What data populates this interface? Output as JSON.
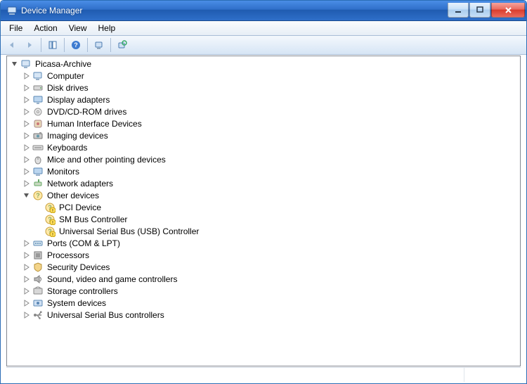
{
  "window_title": "Device Manager",
  "menu": {
    "file": "File",
    "action": "Action",
    "view": "View",
    "help": "Help"
  },
  "root": {
    "label": "Picasa-Archive"
  },
  "categories": [
    {
      "label": "Computer",
      "icon": "computer"
    },
    {
      "label": "Disk drives",
      "icon": "disk"
    },
    {
      "label": "Display adapters",
      "icon": "display"
    },
    {
      "label": "DVD/CD-ROM drives",
      "icon": "cdrom"
    },
    {
      "label": "Human Interface Devices",
      "icon": "hid"
    },
    {
      "label": "Imaging devices",
      "icon": "imaging"
    },
    {
      "label": "Keyboards",
      "icon": "keyboard"
    },
    {
      "label": "Mice and other pointing devices",
      "icon": "mouse"
    },
    {
      "label": "Monitors",
      "icon": "monitor"
    },
    {
      "label": "Network adapters",
      "icon": "network"
    },
    {
      "label": "Other devices",
      "icon": "other",
      "expanded": true,
      "children": [
        {
          "label": "PCI Device"
        },
        {
          "label": "SM Bus Controller"
        },
        {
          "label": "Universal Serial Bus (USB) Controller"
        }
      ]
    },
    {
      "label": "Ports (COM & LPT)",
      "icon": "port"
    },
    {
      "label": "Processors",
      "icon": "cpu"
    },
    {
      "label": "Security Devices",
      "icon": "security"
    },
    {
      "label": "Sound, video and game controllers",
      "icon": "sound"
    },
    {
      "label": "Storage controllers",
      "icon": "storage"
    },
    {
      "label": "System devices",
      "icon": "system"
    },
    {
      "label": "Universal Serial Bus controllers",
      "icon": "usb"
    }
  ]
}
